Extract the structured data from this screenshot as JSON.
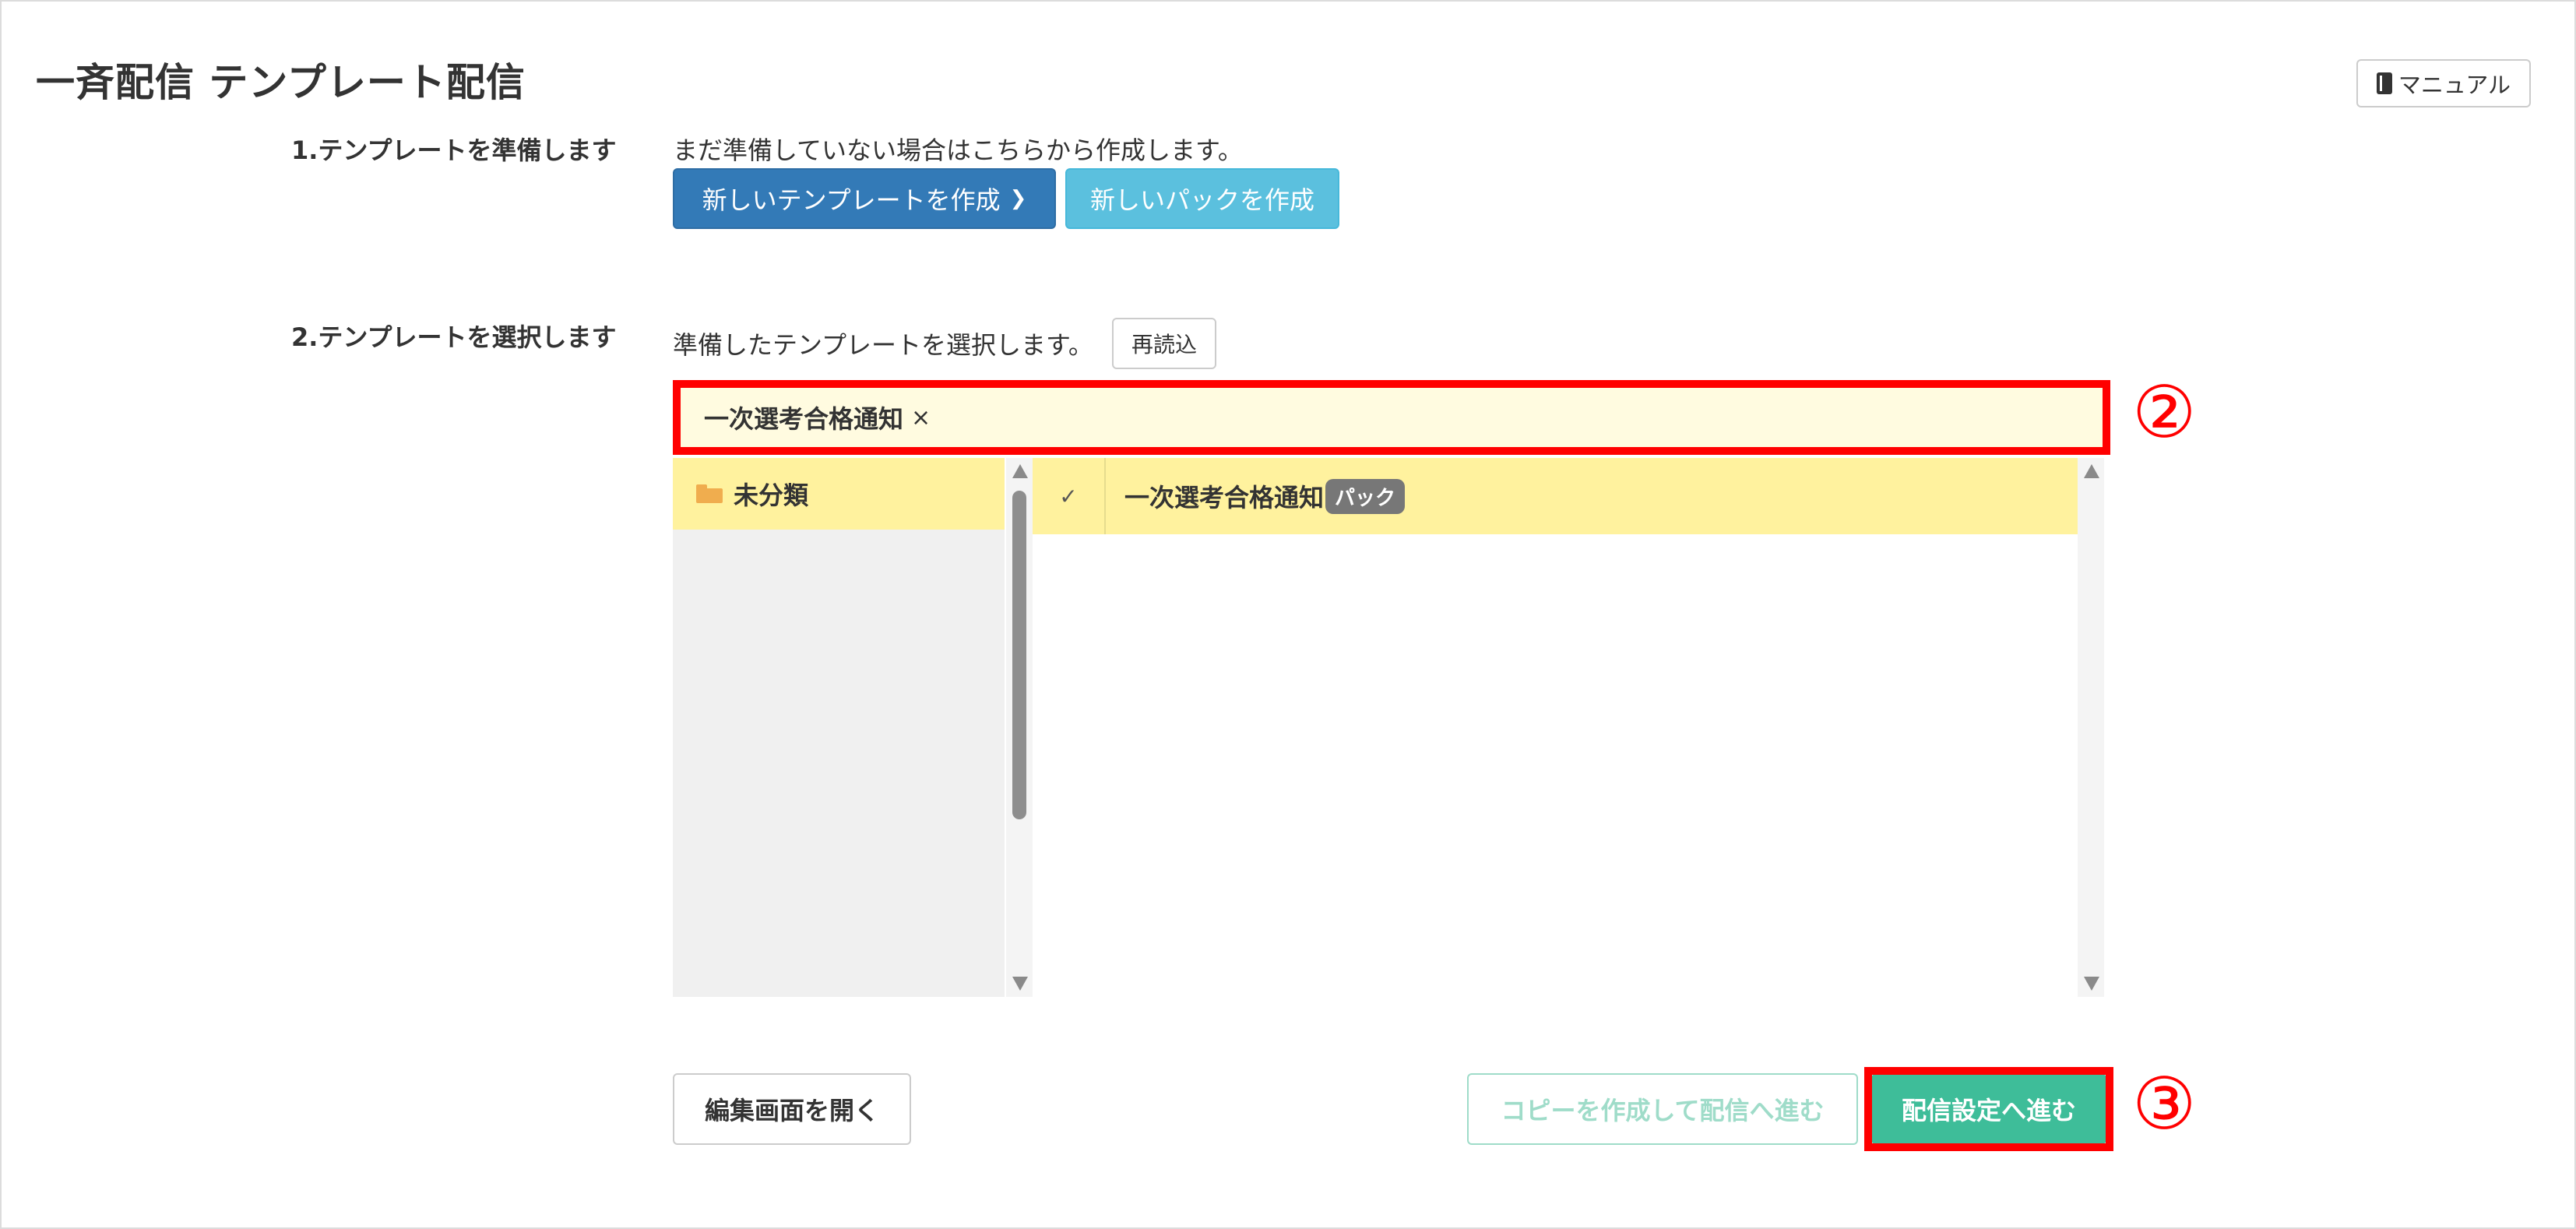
{
  "page": {
    "title": "一斉配信 テンプレート配信"
  },
  "header": {
    "manual_label": "マニュアル"
  },
  "step1": {
    "label": "1.テンプレートを準備します",
    "hint": "まだ準備していない場合はこちらから作成します。",
    "new_template_label": "新しいテンプレートを作成",
    "new_pack_label": "新しいパックを作成"
  },
  "step2": {
    "label": "2.テンプレートを選択します",
    "hint": "準備したテンプレートを選択します。",
    "reload_label": "再読込"
  },
  "selection": {
    "selected_item": "一次選考合格通知",
    "remove_glyph": "×"
  },
  "annotations": {
    "marker_2": "②",
    "marker_3": "③"
  },
  "folders": [
    {
      "label": "未分類"
    }
  ],
  "templates": [
    {
      "check": "✓",
      "name": "一次選考合格通知",
      "badge": "パック"
    }
  ],
  "actions": {
    "edit_label": "編集画面を開く",
    "copy_label": "コピーを作成して配信へ進む",
    "proceed_label": "配信設定へ進む"
  },
  "colors": {
    "primary": "#337ab7",
    "info": "#5bc0de",
    "success": "#3ebd99",
    "highlight": "#fff29e",
    "annotation": "#ff0000"
  }
}
